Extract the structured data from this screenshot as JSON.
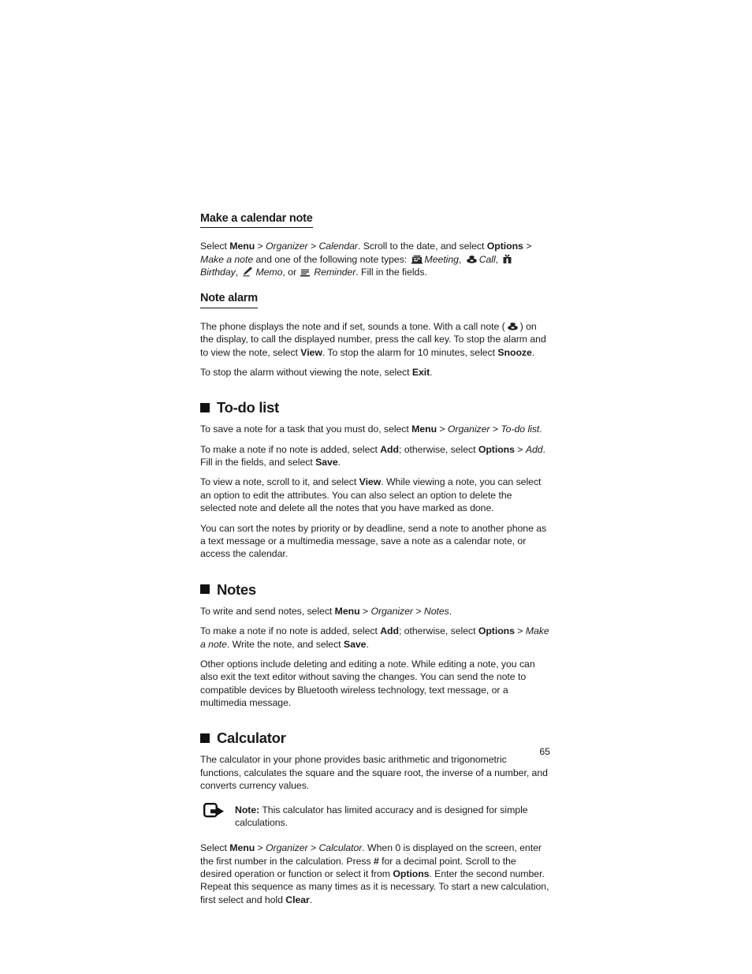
{
  "page": {
    "number": "65"
  },
  "sections": [
    {
      "id": "make-a-calendar-note",
      "heading": "Make a calendar note",
      "heading_style": "underlined-sub"
    },
    {
      "id": "note-alarm",
      "heading": "Note alarm",
      "heading_style": "underlined-sub"
    },
    {
      "id": "to-do-list",
      "heading": "To-do list",
      "heading_style": "bullet-main"
    },
    {
      "id": "notes",
      "heading": "Notes",
      "heading_style": "bullet-main"
    },
    {
      "id": "calculator",
      "heading": "Calculator",
      "heading_style": "bullet-main"
    }
  ],
  "calendar_note": {
    "p1_a": "Select ",
    "p1_menu": "Menu",
    "p1_b": " > ",
    "p1_organizer": "Organizer",
    "p1_c": " > ",
    "p1_calendar": "Calendar",
    "p1_d": ". Scroll to the date, and select ",
    "p1_options": "Options",
    "p1_e": " > ",
    "p1_makeanote": "Make a note",
    "p1_f": " and one of the following note types: ",
    "type_meeting": "Meeting",
    "type_meeting_sep": ", ",
    "type_call": "Call",
    "type_call_sep": ", ",
    "type_birthday": "Birthday",
    "type_birthday_sep": ", ",
    "type_memo": "Memo",
    "type_memo_sep": ", or ",
    "type_reminder": "Reminder",
    "p1_g": ". Fill in the fields."
  },
  "note_alarm": {
    "p1_a": "The phone displays the note and if set, sounds a tone. With a call note (",
    "p1_b": ") on the display, to call the displayed number, press the call key. To stop the alarm and to view the note, select ",
    "p1_view": "View",
    "p1_c": ". To stop the alarm for 10 minutes, select ",
    "p1_snooze": "Snooze",
    "p1_d": ".",
    "p2_a": "To stop the alarm without viewing the note, select ",
    "p2_exit": "Exit",
    "p2_b": "."
  },
  "todo_list": {
    "p1_a": "To save a note for a task that you must do, select ",
    "p1_menu": "Menu",
    "p1_b": " > ",
    "p1_organizer": "Organizer",
    "p1_c": " > ",
    "p1_todo": "To-do list",
    "p1_d": ".",
    "p2_a": "To make a note if no note is added, select ",
    "p2_add": "Add",
    "p2_b": "; otherwise, select ",
    "p2_options": "Options",
    "p2_c": " > ",
    "p2_add2": "Add",
    "p2_d": ". Fill in the fields, and select ",
    "p2_save": "Save",
    "p2_e": ".",
    "p3_a": "To view a note, scroll to it, and select ",
    "p3_view": "View",
    "p3_b": ". While viewing a note, you can select an option to edit the attributes. You can also select an option to delete the selected note and delete all the notes that you have marked as done.",
    "p4": "You can sort the notes by priority or by deadline, send a note to another phone as a text message or a multimedia message, save a note as a calendar note, or access the calendar."
  },
  "notes": {
    "p1_a": "To write and send notes, select ",
    "p1_menu": "Menu",
    "p1_b": " > ",
    "p1_organizer": "Organizer",
    "p1_c": " > ",
    "p1_notes": "Notes",
    "p1_d": ".",
    "p2_a": "To make a note if no note is added, select ",
    "p2_add": "Add",
    "p2_b": "; otherwise, select ",
    "p2_options": "Options",
    "p2_c": " > ",
    "p2_makeanote": "Make a note",
    "p2_d": ". Write the note, and select ",
    "p2_save": "Save",
    "p2_e": ".",
    "p3": "Other options include deleting and editing a note. While editing a note, you can also exit the text editor without saving the changes. You can send the note to compatible devices by Bluetooth wireless technology, text message, or a multimedia message."
  },
  "calculator": {
    "p1": "The calculator in your phone provides basic arithmetic and trigonometric functions, calculates the square and the square root, the inverse of a number, and converts currency values.",
    "note_label": "Note:",
    "note_body": " This calculator has limited accuracy and is designed for simple calculations.",
    "p2_a": "Select ",
    "p2_menu": "Menu",
    "p2_b": " > ",
    "p2_organizer": "Organizer",
    "p2_c": " > ",
    "p2_calculator": "Calculator",
    "p2_d": ". When 0 is displayed on the screen, enter the first number in the calculation. Press ",
    "p2_hash": "#",
    "p2_e": " for a decimal point. Scroll to the desired operation or function or select it from ",
    "p2_options": "Options",
    "p2_f": ". Enter the second number. Repeat this sequence as many times as it is necessary. To start a new calculation, first select and hold ",
    "p2_clear": "Clear",
    "p2_g": "."
  },
  "icons": {
    "meeting": "meeting-icon",
    "call": "telephone-icon",
    "birthday": "gift-icon",
    "memo": "memo-pencil-icon",
    "reminder": "reminder-lines-icon",
    "note": "note-arrow-icon",
    "bullet": "square-bullet-icon"
  },
  "colors": {
    "text": "#1a1a1a",
    "rule": "#111111"
  }
}
